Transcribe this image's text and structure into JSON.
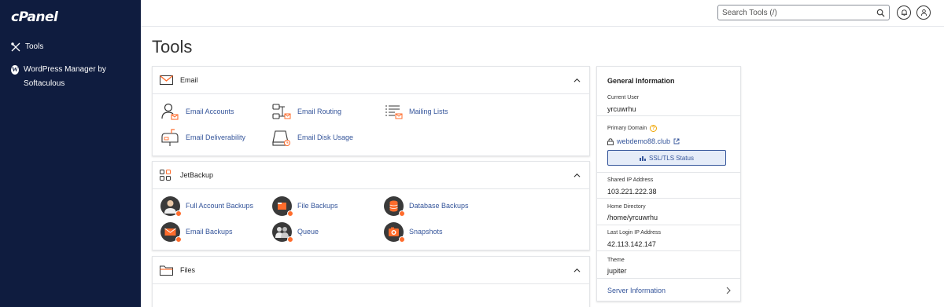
{
  "brand": {
    "logo": "cPanel"
  },
  "sidebar": {
    "items": [
      {
        "label": "Tools",
        "icon": "tools-icon"
      },
      {
        "label": "WordPress Manager by Softaculous",
        "icon": "wordpress-icon"
      }
    ]
  },
  "topbar": {
    "search_placeholder": "Search Tools (/)",
    "notifications_icon": "bell-icon",
    "user_icon": "user-icon"
  },
  "page": {
    "title": "Tools"
  },
  "panels": {
    "email": {
      "title": "Email",
      "tools": [
        {
          "label": "Email Accounts",
          "icon": "email-accounts-icon"
        },
        {
          "label": "Email Routing",
          "icon": "email-routing-icon"
        },
        {
          "label": "Mailing Lists",
          "icon": "mailing-lists-icon"
        },
        {
          "label": "Email Deliverability",
          "icon": "email-deliverability-icon"
        },
        {
          "label": "Email Disk Usage",
          "icon": "email-disk-usage-icon"
        }
      ]
    },
    "jetbackup": {
      "title": "JetBackup",
      "tools": [
        {
          "label": "Full Account Backups",
          "icon": "full-account-backups-icon"
        },
        {
          "label": "File Backups",
          "icon": "file-backups-icon"
        },
        {
          "label": "Database Backups",
          "icon": "database-backups-icon"
        },
        {
          "label": "Email Backups",
          "icon": "email-backups-icon"
        },
        {
          "label": "Queue",
          "icon": "queue-icon"
        },
        {
          "label": "Snapshots",
          "icon": "snapshots-icon"
        }
      ]
    },
    "files": {
      "title": "Files"
    }
  },
  "general_info": {
    "title": "General Information",
    "current_user_label": "Current User",
    "current_user": "yrcuwrhu",
    "primary_domain_label": "Primary Domain",
    "primary_domain": "webdemo88.club",
    "ssl_button": "SSL/TLS Status",
    "shared_ip_label": "Shared IP Address",
    "shared_ip": "103.221.222.38",
    "home_dir_label": "Home Directory",
    "home_dir": "/home/yrcuwrhu",
    "last_login_label": "Last Login IP Address",
    "last_login": "42.113.142.147",
    "theme_label": "Theme",
    "theme": "jupiter",
    "server_info": "Server Information"
  },
  "colors": {
    "sidebar_bg": "#0f1c3f",
    "link": "#36569b",
    "accent_orange": "#ff6c2c"
  }
}
